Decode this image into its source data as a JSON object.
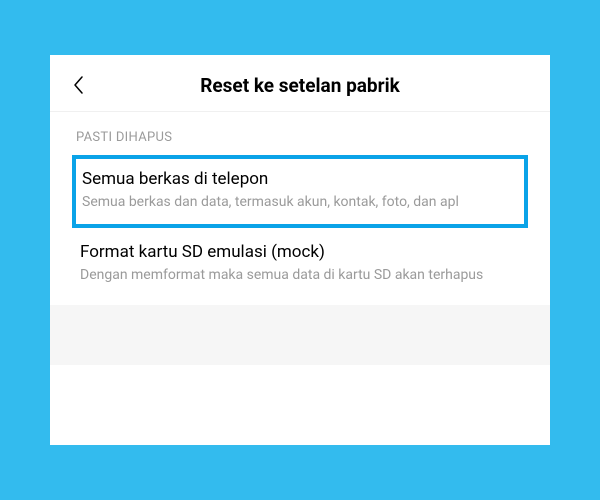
{
  "header": {
    "title": "Reset ke setelan pabrik"
  },
  "section": {
    "label": "PASTI DIHAPUS"
  },
  "items": [
    {
      "title": "Semua berkas di telepon",
      "description": "Semua berkas dan data, termasuk akun, kontak, foto, dan apl"
    },
    {
      "title": "Format kartu SD emulasi (mock)",
      "description": "Dengan memformat maka semua data di kartu SD akan terhapus"
    }
  ],
  "colors": {
    "highlight": "#0aa3e8",
    "background": "#33bbee"
  }
}
